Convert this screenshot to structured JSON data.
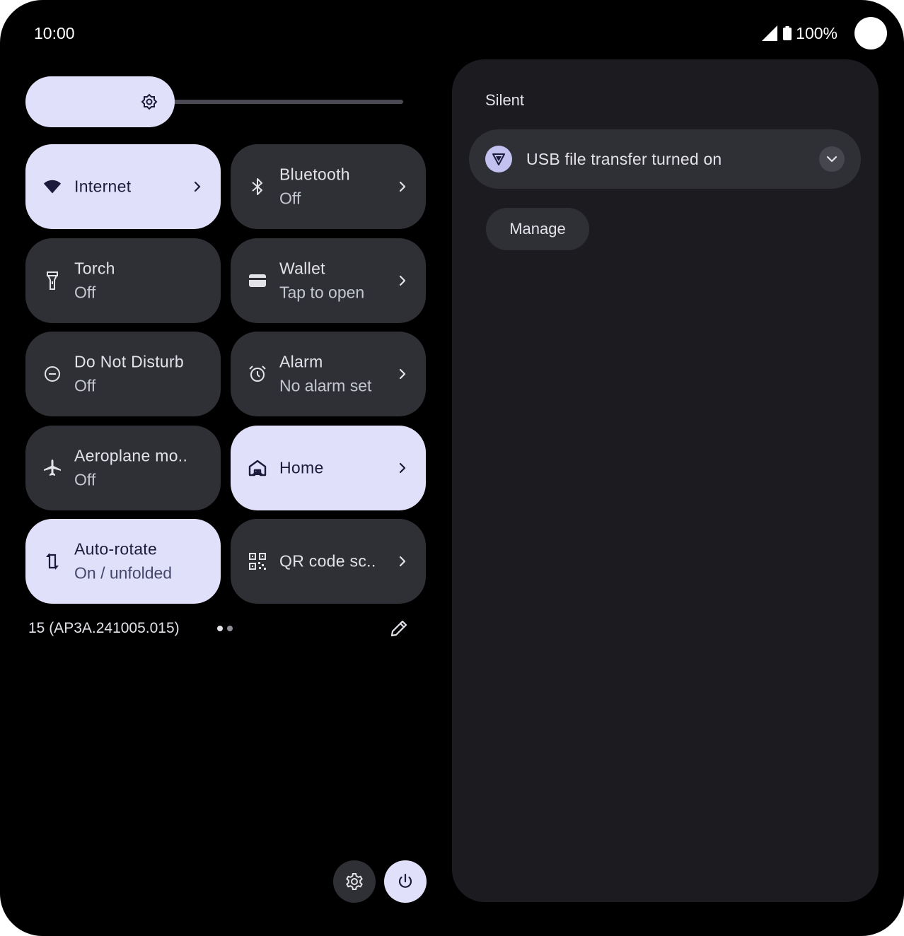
{
  "status_bar": {
    "time": "10:00",
    "battery": "100%"
  },
  "brightness": {
    "level": 0.36
  },
  "tiles": [
    {
      "title": "Internet",
      "subtitle": "",
      "icon": "wifi-icon",
      "active": true,
      "chevron": true
    },
    {
      "title": "Bluetooth",
      "subtitle": "Off",
      "icon": "bluetooth-icon",
      "active": false,
      "chevron": true
    },
    {
      "title": "Torch",
      "subtitle": "Off",
      "icon": "torch-icon",
      "active": false,
      "chevron": false
    },
    {
      "title": "Wallet",
      "subtitle": "Tap to open",
      "icon": "wallet-icon",
      "active": false,
      "chevron": true
    },
    {
      "title": "Do Not Disturb",
      "subtitle": "Off",
      "icon": "do-not-disturb-icon",
      "active": false,
      "chevron": false
    },
    {
      "title": "Alarm",
      "subtitle": "No alarm set",
      "icon": "alarm-icon",
      "active": false,
      "chevron": true
    },
    {
      "title": "Aeroplane mo..",
      "subtitle": "Off",
      "icon": "airplane-icon",
      "active": false,
      "chevron": false
    },
    {
      "title": "Home",
      "subtitle": "",
      "icon": "home-icon",
      "active": true,
      "chevron": true
    },
    {
      "title": "Auto-rotate",
      "subtitle": "On / unfolded",
      "icon": "auto-rotate-icon",
      "active": true,
      "chevron": false
    },
    {
      "title": "QR code sc..",
      "subtitle": "",
      "icon": "qr-code-icon",
      "active": false,
      "chevron": true
    }
  ],
  "footer": {
    "build": "15 (AP3A.241005.015)",
    "pages": 2,
    "current_page": 1
  },
  "notifications": {
    "section_label": "Silent",
    "items": [
      {
        "text": "USB file transfer turned on",
        "icon": "usb-shield-icon"
      }
    ],
    "manage_label": "Manage"
  },
  "colors": {
    "active_tile": "#e1e0fa",
    "inactive_tile": "#2f3036",
    "panel": "#1b1b20"
  }
}
